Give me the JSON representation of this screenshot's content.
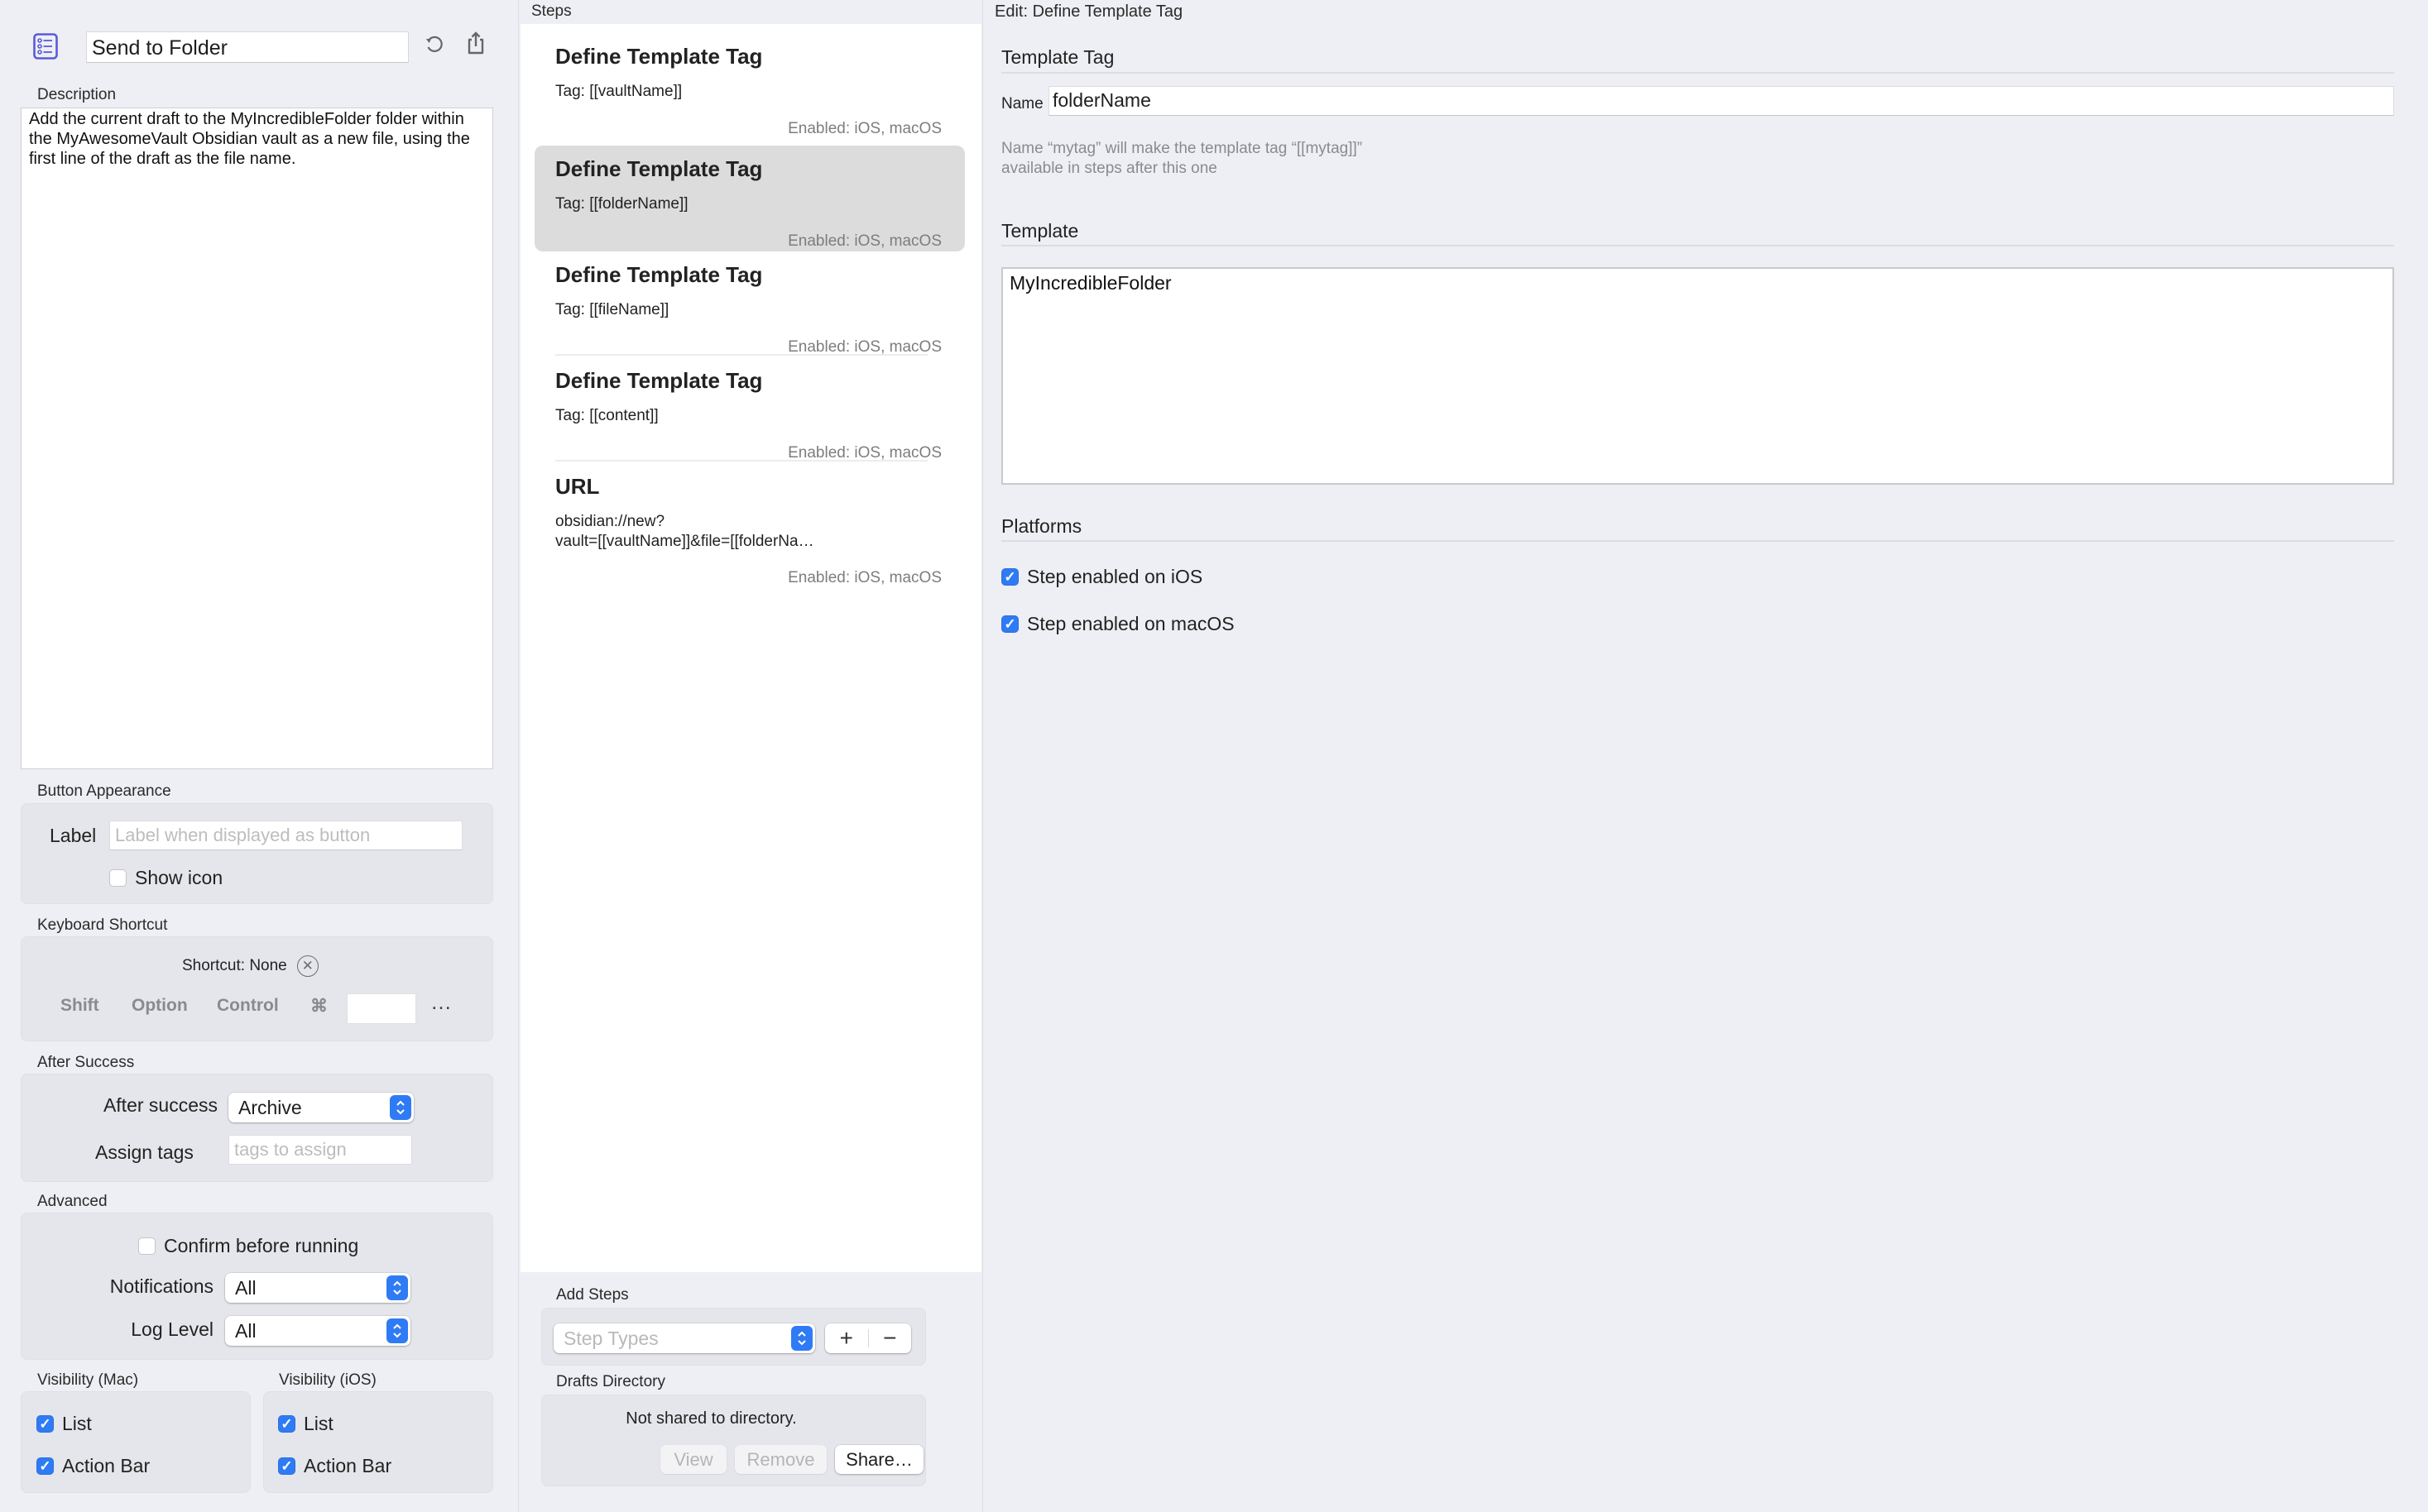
{
  "action": {
    "icon": "list-icon",
    "title": "Send to Folder",
    "undo_icon": "undo-icon",
    "share_icon": "share-icon",
    "description_label": "Description",
    "description": "Add the current draft to the MyIncredibleFolder folder within the MyAwesomeVault Obsidian vault as a new file, using the first line of the draft as the file name."
  },
  "button_appearance": {
    "section_label": "Button Appearance",
    "label_label": "Label",
    "label_placeholder": "Label when displayed as button",
    "label_value": "",
    "show_icon_label": "Show icon",
    "show_icon_checked": false
  },
  "keyboard_shortcut": {
    "section_label": "Keyboard Shortcut",
    "status": "Shortcut: None",
    "clear_icon": "clear-circle-icon",
    "modifiers": [
      "Shift",
      "Option",
      "Control",
      "⌘"
    ],
    "key_value": "",
    "more_label": "…"
  },
  "after_success": {
    "section_label": "After Success",
    "after_success_label": "After success",
    "after_success_value": "Archive",
    "assign_tags_label": "Assign tags",
    "assign_tags_placeholder": "tags to assign",
    "assign_tags_value": ""
  },
  "advanced": {
    "section_label": "Advanced",
    "confirm_label": "Confirm before running",
    "confirm_checked": false,
    "notifications_label": "Notifications",
    "notifications_value": "All",
    "log_level_label": "Log Level",
    "log_level_value": "All"
  },
  "visibility": {
    "mac": {
      "section_label": "Visibility (Mac)",
      "items": [
        {
          "label": "List",
          "checked": true
        },
        {
          "label": "Action Bar",
          "checked": true
        }
      ]
    },
    "ios": {
      "section_label": "Visibility (iOS)",
      "items": [
        {
          "label": "List",
          "checked": true
        },
        {
          "label": "Action Bar",
          "checked": true
        }
      ]
    }
  },
  "steps": {
    "header": "Steps",
    "items": [
      {
        "title": "Define Template Tag",
        "subtitle": "Tag: [[vaultName]]",
        "status": "Enabled: iOS, macOS",
        "selected": false
      },
      {
        "title": "Define Template Tag",
        "subtitle": "Tag: [[folderName]]",
        "status": "Enabled: iOS, macOS",
        "selected": true
      },
      {
        "title": "Define Template Tag",
        "subtitle": "Tag: [[fileName]]",
        "status": "Enabled: iOS, macOS",
        "selected": false
      },
      {
        "title": "Define Template Tag",
        "subtitle": "Tag: [[content]]",
        "status": "Enabled: iOS, macOS",
        "selected": false
      },
      {
        "title": "URL",
        "subtitle": "obsidian://new?\nvault=[[vaultName]]&file=[[folderNa…",
        "status": "Enabled: iOS, macOS",
        "selected": false
      }
    ],
    "add_steps": {
      "section_label": "Add Steps",
      "step_types_placeholder": "Step Types",
      "add_label": "+",
      "remove_label": "−"
    },
    "drafts_directory": {
      "section_label": "Drafts Directory",
      "status": "Not shared to directory.",
      "view_label": "View",
      "remove_label": "Remove",
      "share_label": "Share…"
    }
  },
  "editor": {
    "title": "Edit: Define Template Tag",
    "template_tag_section": "Template Tag",
    "name_label": "Name",
    "name_value": "folderName",
    "name_hint": "Name “mytag” will make the template tag “[[mytag]]”\navailable in steps after this one",
    "template_section": "Template",
    "template_value": "MyIncredibleFolder",
    "platforms_section": "Platforms",
    "platforms": [
      {
        "label": "Step enabled on iOS",
        "checked": true
      },
      {
        "label": "Step enabled on macOS",
        "checked": true
      }
    ]
  },
  "colors": {
    "accent": "#2f7bf5",
    "icon_purple": "#5b5bd6",
    "selected_row": "#dcdcdc",
    "background": "#eeeff4"
  }
}
